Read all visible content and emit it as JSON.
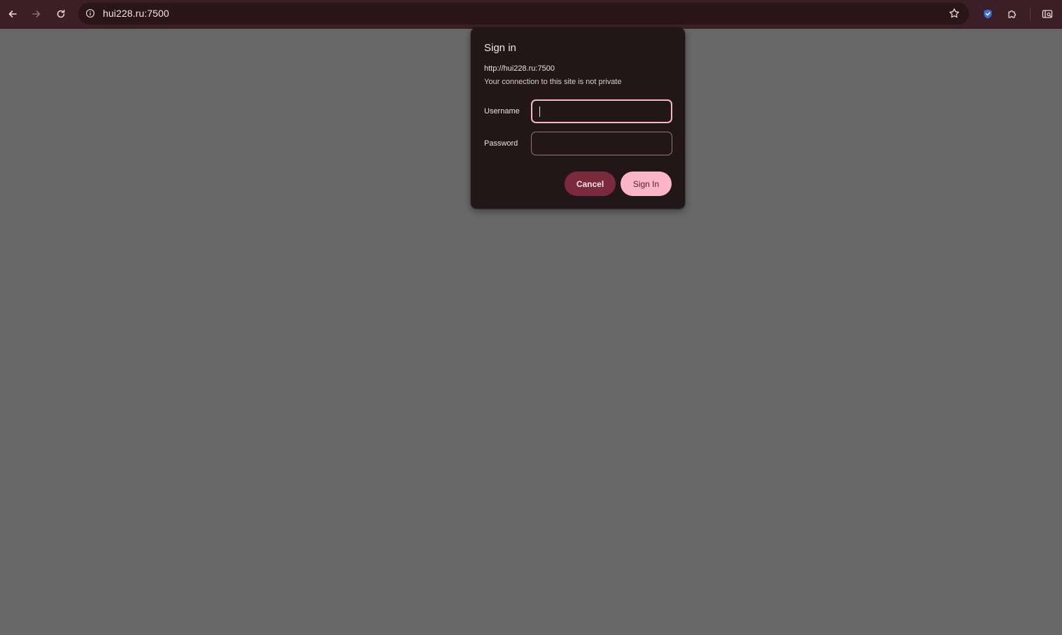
{
  "browser": {
    "url": "hui228.ru:7500",
    "colors": {
      "toolbar_bg": "#3c1f26",
      "omnibox_bg": "#2a1519",
      "page_bg": "#686868"
    },
    "icons": {
      "back": "arrow-left-icon",
      "forward": "arrow-right-icon",
      "reload": "reload-icon",
      "site_info": "info-circle-icon",
      "bookmark": "star-icon",
      "extension_1": "shield-extension-icon",
      "extensions": "puzzle-icon",
      "side_panel": "side-panel-search-icon"
    }
  },
  "dialog": {
    "title": "Sign in",
    "origin": "http://hui228.ru:7500",
    "warning": "Your connection to this site is not private",
    "username_label": "Username",
    "username_value": "",
    "password_label": "Password",
    "password_value": "",
    "cancel_label": "Cancel",
    "signin_label": "Sign In",
    "colors": {
      "dialog_bg": "#231618",
      "focus_ring": "#f5b8c8",
      "cancel_bg": "#7a2a3c",
      "signin_bg": "#fcb6c7"
    }
  }
}
